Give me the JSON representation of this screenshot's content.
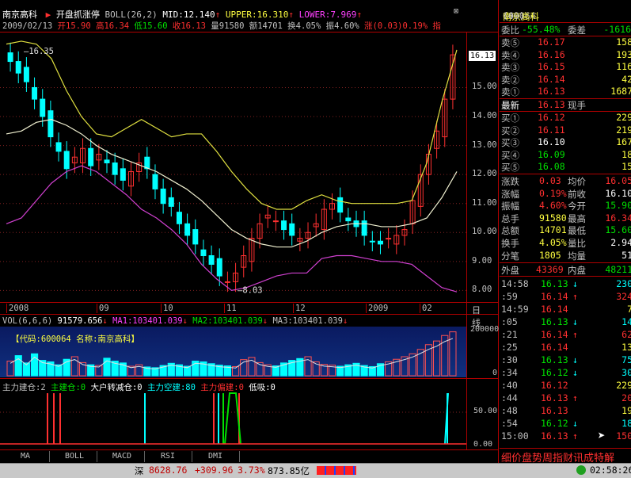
{
  "header": {
    "stock_name": "南京高科",
    "indicator_name": "开盘抓涨停",
    "boll_label": "BOLL(26,2)",
    "mid": "MID:12.140",
    "upper": "UPPER:16.310",
    "lower": "LOWER:7.969"
  },
  "info": {
    "date": "2009/02/13",
    "open": "开15.90",
    "high": "高16.34",
    "low": "低15.60",
    "close": "收16.13",
    "volume": "量91580",
    "amount": "额14701",
    "turnover": "换4.05%",
    "amplitude": "振4.60%",
    "change": "涨(0.03)0.19%",
    "more": "指"
  },
  "chart_data": {
    "type": "candlestick",
    "price_axis_ticks": [
      "15.00",
      "14.00",
      "13.00",
      "12.00",
      "11.00",
      "10.00",
      "9.00",
      "8.00"
    ],
    "price_range": [
      7.6,
      16.9
    ],
    "high_label": "16.35",
    "low_label": "8.03",
    "current_price_tag": "16.13",
    "x_labels": [
      "2008",
      "09",
      "10",
      "11",
      "12",
      "2009",
      "02"
    ],
    "x_right_label": "日线",
    "mid_series": [
      13.4,
      13.5,
      13.8,
      13.9,
      13.7,
      13.4,
      13.0,
      12.7,
      12.5,
      12.3,
      12.1,
      11.8,
      11.5,
      11.1,
      10.6,
      10.1,
      9.8,
      9.6,
      9.5,
      9.5,
      9.7,
      10.0,
      10.2,
      10.3,
      10.3,
      10.2,
      10.2,
      10.3,
      10.5,
      11.2,
      12.1
    ],
    "upper_series": [
      16.5,
      16.6,
      16.5,
      16.0,
      14.9,
      14.0,
      13.4,
      13.3,
      13.6,
      13.9,
      13.6,
      13.3,
      13.4,
      13.4,
      12.8,
      12.1,
      11.5,
      11.0,
      10.8,
      10.8,
      11.1,
      11.3,
      11.1,
      11.0,
      11.0,
      11.0,
      11.0,
      11.1,
      12.4,
      14.5,
      16.3
    ],
    "lower_series": [
      10.3,
      10.5,
      11.1,
      11.7,
      12.1,
      12.3,
      12.1,
      11.7,
      11.3,
      10.8,
      10.5,
      10.1,
      9.6,
      8.9,
      8.4,
      8.0,
      8.1,
      8.3,
      8.5,
      8.6,
      8.6,
      9.1,
      9.2,
      9.2,
      9.1,
      9.0,
      9.0,
      8.9,
      8.5,
      8.1,
      7.95
    ],
    "closes": [
      15.9,
      15.5,
      15.2,
      14.6,
      14.0,
      13.3,
      12.8,
      12.2,
      12.6,
      12.9,
      12.3,
      12.7,
      12.4,
      12.0,
      11.8,
      12.1,
      12.4,
      12.2,
      11.5,
      11.0,
      10.9,
      10.3,
      9.9,
      9.6,
      9.2,
      8.9,
      8.5,
      8.3,
      8.6,
      9.2,
      9.8,
      10.3,
      10.6,
      10.4,
      10.1,
      9.9,
      9.8,
      10.0,
      10.3,
      10.8,
      11.0,
      10.7,
      10.4,
      10.2,
      9.9,
      9.7,
      9.6,
      9.8,
      9.9,
      10.1,
      11.1,
      12.0,
      12.7,
      13.5,
      14.6,
      16.13
    ],
    "vol_header": {
      "label": "VOL(6,6,6)",
      "vol": "91579.656",
      "ma1": "MA1:103401.039",
      "ma2": "MA2:103401.039",
      "ma3": "MA3:103401.039"
    },
    "vol_code_label": "【代码:600064 名称:南京高科】",
    "vol_axis_ticks": [
      "200000",
      "0"
    ],
    "vol_values": [
      40,
      55,
      35,
      60,
      42,
      38,
      30,
      45,
      52,
      36,
      30,
      28,
      48,
      40,
      35,
      26,
      30,
      24,
      22,
      28,
      34,
      30,
      26,
      40,
      38,
      33,
      29,
      27,
      25,
      44,
      50,
      36,
      30,
      27,
      35,
      42,
      47,
      52,
      38,
      31,
      29,
      26,
      30,
      34,
      28,
      25,
      33,
      38,
      45,
      52,
      60,
      72,
      85,
      95,
      110,
      120
    ],
    "ind_header": {
      "a": "主力建仓:2",
      "b": "主建仓:0",
      "c": "大户转减仓:0",
      "d": "主力空建:80",
      "e": "主力偏建:0",
      "f": "低吸:0"
    },
    "ind_axis_ticks": [
      "50.00",
      "0.00"
    ]
  },
  "quote": {
    "code": "600064",
    "name": "南京高科",
    "count": "(49)",
    "weibi_label": "委比",
    "weibi_value": "-55.48%",
    "weicha_label": "委差",
    "weicha_value": "-1616",
    "asks": [
      {
        "label": "卖⑤",
        "price": "16.17",
        "vol": "158"
      },
      {
        "label": "卖④",
        "price": "16.16",
        "vol": "193"
      },
      {
        "label": "卖③",
        "price": "16.15",
        "vol": "116"
      },
      {
        "label": "卖②",
        "price": "16.14",
        "vol": "42"
      },
      {
        "label": "卖①",
        "price": "16.13",
        "vol": "1687"
      }
    ],
    "last_label": "最新",
    "last_price": "16.13",
    "last_vol_label": "现手",
    "last_vol": "",
    "bids": [
      {
        "label": "买①",
        "price": "16.12",
        "vol": "229"
      },
      {
        "label": "买②",
        "price": "16.11",
        "vol": "219"
      },
      {
        "label": "买③",
        "price": "16.10",
        "vol": "167"
      },
      {
        "label": "买④",
        "price": "16.09",
        "vol": "18"
      },
      {
        "label": "买⑤",
        "price": "16.08",
        "vol": "15"
      }
    ],
    "stats": [
      {
        "l1": "涨跌",
        "v1": "0.03",
        "l2": "均价",
        "v2": "16.05"
      },
      {
        "l1": "涨幅",
        "v1": "0.19%",
        "l2": "前收",
        "v2": "16.10"
      },
      {
        "l1": "振幅",
        "v1": "4.60%",
        "l2": "今开",
        "v2": "15.90"
      },
      {
        "l1": "总手",
        "v1": "91580",
        "l2": "最高",
        "v2": "16.34"
      },
      {
        "l1": "总额",
        "v1": "14701",
        "l2": "最低",
        "v2": "15.60"
      },
      {
        "l1": "换手",
        "v1": "4.05%",
        "l2": "量比",
        "v2": "2.94"
      },
      {
        "l1": "分笔",
        "v1": "1805",
        "l2": "均量",
        "v2": "51"
      }
    ],
    "outer_label": "外盘",
    "outer_value": "43369",
    "inner_label": "内盘",
    "inner_value": "48211",
    "ticks": [
      {
        "time": "14:58",
        "price": "16.13",
        "dir": "↓",
        "vol": "230",
        "sub": "9"
      },
      {
        "time": ":59",
        "price": "16.14",
        "dir": "↑",
        "vol": "324",
        "sub": ""
      },
      {
        "time": "14:59",
        "price": "16.14",
        "dir": "",
        "vol": "7",
        "sub": ""
      },
      {
        "time": ":05",
        "price": "16.13",
        "dir": "↓",
        "vol": "14",
        "sub": ""
      },
      {
        "time": ":21",
        "price": "16.14",
        "dir": "↑",
        "vol": "62",
        "sub": ""
      },
      {
        "time": ":25",
        "price": "16.14",
        "dir": "",
        "vol": "13",
        "sub": ""
      },
      {
        "time": ":30",
        "price": "16.13",
        "dir": "↓",
        "vol": "75",
        "sub": ""
      },
      {
        "time": ":34",
        "price": "16.12",
        "dir": "↓",
        "vol": "30",
        "sub": ""
      },
      {
        "time": ":40",
        "price": "16.12",
        "dir": "",
        "vol": "229",
        "sub": ""
      },
      {
        "time": ":44",
        "price": "16.13",
        "dir": "↑",
        "vol": "20",
        "sub": ""
      },
      {
        "time": ":48",
        "price": "16.13",
        "dir": "",
        "vol": "19",
        "sub": ""
      },
      {
        "time": ":54",
        "price": "16.12",
        "dir": "↓",
        "vol": "18",
        "sub": ""
      },
      {
        "time": "15:00",
        "price": "16.13",
        "dir": "↑",
        "vol": "150",
        "sub": ""
      }
    ],
    "bottom_tabs": "细价盘势周指财讯成特解"
  },
  "tabs": [
    "MA",
    "BOLL",
    "MACD",
    "RSI",
    "DMI"
  ],
  "status": {
    "market": "深",
    "index": "8628.76",
    "change": "+309.96",
    "pct": "3.73%",
    "amount": "873.85亿",
    "time": "02:58:26"
  }
}
